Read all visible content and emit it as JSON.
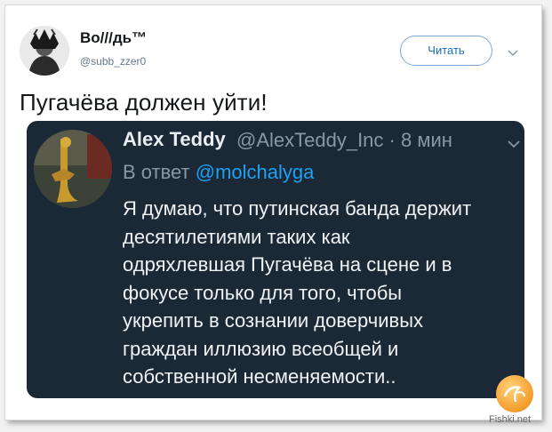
{
  "tweet": {
    "display_name": "Во///дь™",
    "handle": "@subb_zzer0",
    "follow_label": "Читать",
    "text": "Пугачёва должен уйти!"
  },
  "quote": {
    "author_name": "Alex Teddy",
    "meta": "@AlexTeddy_Inc · 8 мин",
    "reply_prefix": "В ответ",
    "reply_mention": "@molchalyga",
    "body_lines": [
      "Я думаю, что путинская банда держит",
      "десятилетиями таких как",
      "одряхлевшая Пугачёва на сцене и в",
      "фокусе только для того, чтобы",
      "укрепить в сознании доверчивых",
      "граждан иллюзию всеобщей и",
      "собственной несменяемости.."
    ]
  },
  "watermark": {
    "logo_text": "Fishki.net"
  },
  "icons": {
    "caret": "chevron-down-icon",
    "avatar": "avatar",
    "quote_avatar": "avatar"
  },
  "colors": {
    "quote_bg": "#1b2836",
    "mention": "#1da1f2",
    "follow": "#1c6fbf"
  }
}
